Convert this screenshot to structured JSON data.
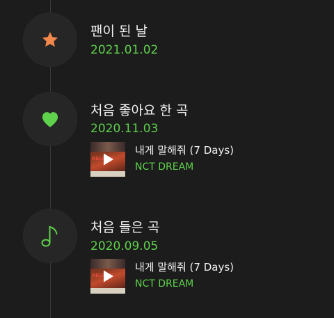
{
  "colors": {
    "background": "#1c1c1c",
    "accent_green": "#5fd14c",
    "star_orange": "#f2884b",
    "line": "#3a3a3a"
  },
  "entries": [
    {
      "icon": "star-icon",
      "title": "팬이 된 날",
      "date": "2021.01.02"
    },
    {
      "icon": "heart-icon",
      "title": "처음 좋아요 한 곡",
      "date": "2020.11.03",
      "song": {
        "title": "내게 말해줘 (7 Days)",
        "artist": "NCT DREAM",
        "album_art_text": "RELOAD"
      }
    },
    {
      "icon": "music-note-icon",
      "title": "처음 들은 곡",
      "date": "2020.09.05",
      "song": {
        "title": "내게 말해줘 (7 Days)",
        "artist": "NCT DREAM",
        "album_art_text": "RELOAD"
      }
    }
  ]
}
